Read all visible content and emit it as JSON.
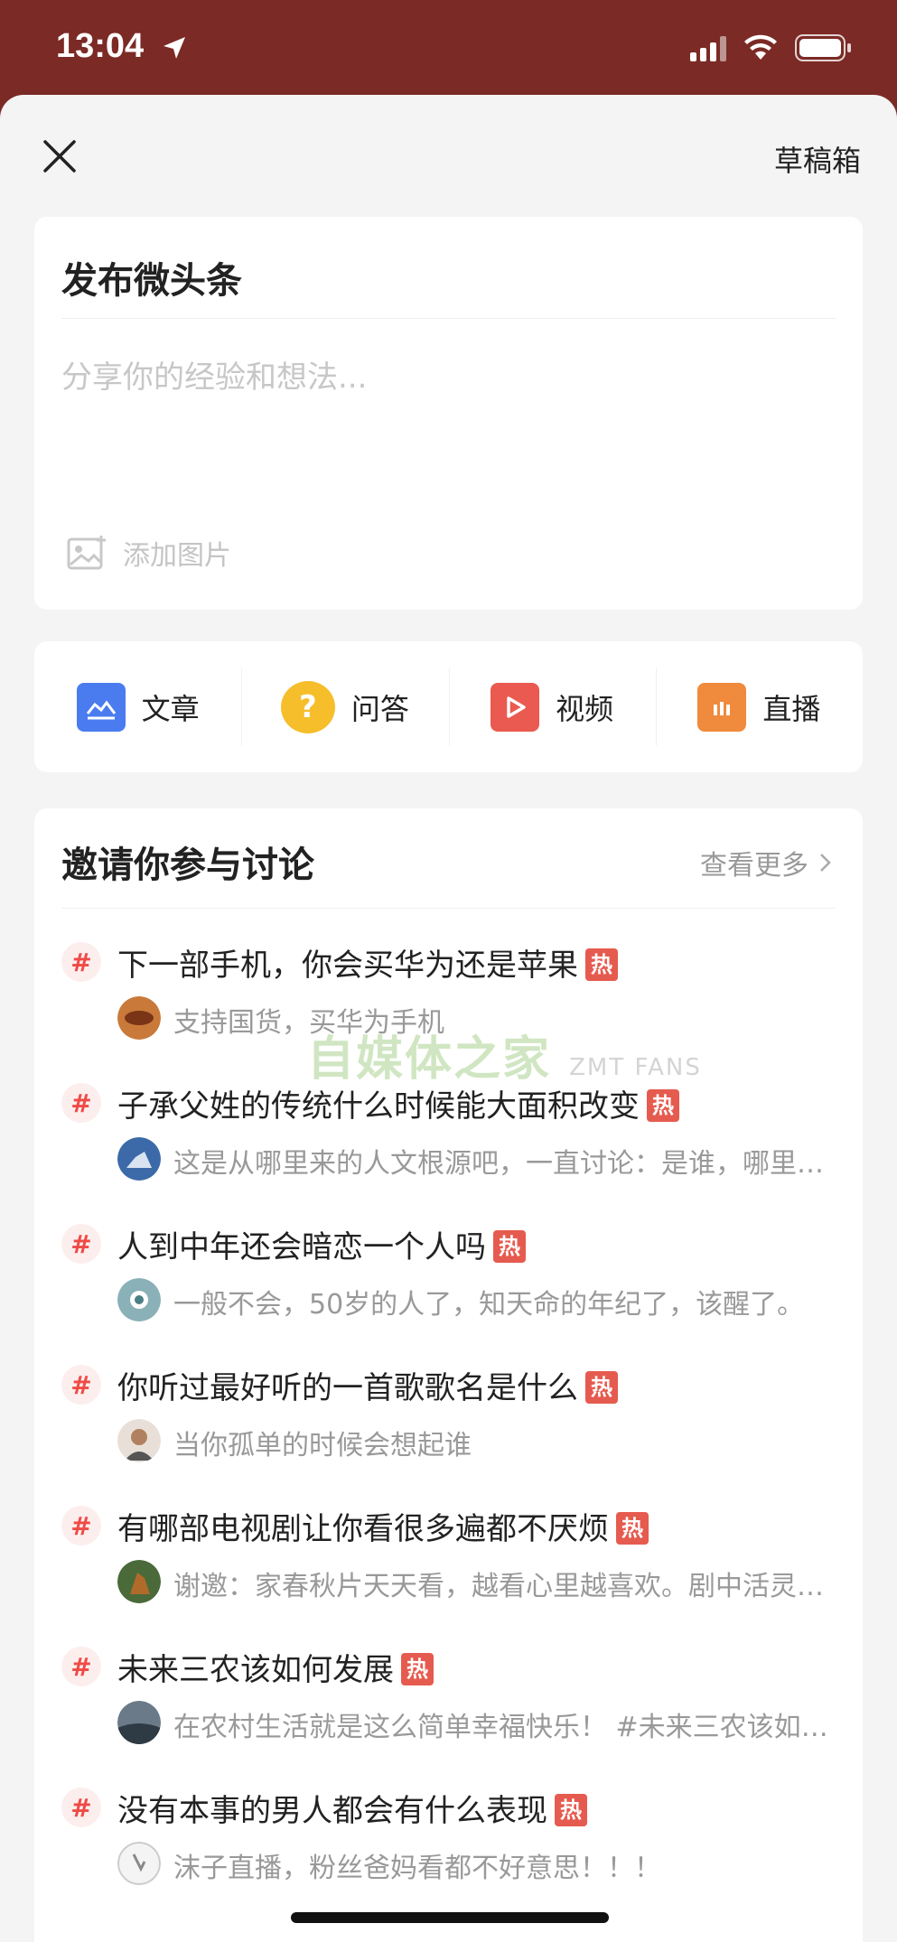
{
  "status_bar": {
    "time": "13:04"
  },
  "header": {
    "drafts_label": "草稿箱"
  },
  "compose": {
    "title": "发布微头条",
    "placeholder": "分享你的经验和想法...",
    "add_image_label": "添加图片"
  },
  "post_types": [
    {
      "label": "文章",
      "icon": "article-icon",
      "color": "#4a7cf0"
    },
    {
      "label": "问答",
      "icon": "qa-icon",
      "color": "#f5be2a"
    },
    {
      "label": "视频",
      "icon": "video-icon",
      "color": "#ea5a50"
    },
    {
      "label": "直播",
      "icon": "live-icon",
      "color": "#f08a3c"
    }
  ],
  "discussion": {
    "title": "邀请你参与讨论",
    "more_label": "查看更多",
    "topics": [
      {
        "title": "下一部手机，你会买华为还是苹果",
        "hot": "热",
        "subtitle": "支持国货，买华为手机"
      },
      {
        "title": "子承父姓的传统什么时候能大面积改变",
        "hot": "热",
        "subtitle": "这是从哪里来的人文根源吧，一直讨论：是谁，哪里来的，到哪里去"
      },
      {
        "title": "人到中年还会暗恋一个人吗",
        "hot": "热",
        "subtitle": "一般不会，50岁的人了，知天命的年纪了，该醒了。"
      },
      {
        "title": "你听过最好听的一首歌歌名是什么",
        "hot": "热",
        "subtitle": "当你孤单的时候会想起谁"
      },
      {
        "title": "有哪部电视剧让你看很多遍都不厌烦",
        "hot": "热",
        "subtitle": "谢邀：家春秋片天天看，越看心里越喜欢。剧中活灵活现的人物"
      },
      {
        "title": "未来三农该如何发展",
        "hot": "热",
        "subtitle": "在农村生活就是这么简单幸福快乐！ #未来三农该如何发展#"
      },
      {
        "title": "没有本事的男人都会有什么表现",
        "hot": "热",
        "subtitle": "沫子直播，粉丝爸妈看都不好意思！！！"
      }
    ]
  },
  "watermark": {
    "text": "自媒体之家",
    "latin": "ZMT FANS"
  }
}
